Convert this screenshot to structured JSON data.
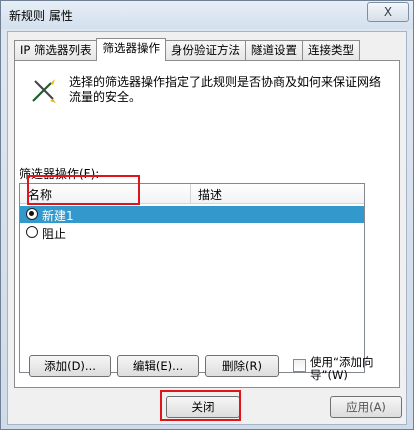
{
  "window": {
    "title": "新规则 属性",
    "close_glyph": "X"
  },
  "tabs": [
    {
      "label": "IP 筛选器列表",
      "active": false
    },
    {
      "label": "筛选器操作",
      "active": true
    },
    {
      "label": "身份验证方法",
      "active": false
    },
    {
      "label": "隧道设置",
      "active": false
    },
    {
      "label": "连接类型",
      "active": false
    }
  ],
  "panel": {
    "description": "选择的筛选器操作指定了此规则是否协商及如何来保证网络流量的安全。",
    "list_label": "筛选器操作(F):",
    "columns": [
      "名称",
      "描述"
    ],
    "rows": [
      {
        "name": "新建1",
        "description": "",
        "checked": true,
        "selected": true
      },
      {
        "name": "阻止",
        "description": "",
        "checked": false,
        "selected": false
      }
    ],
    "buttons": {
      "add": "添加(D)...",
      "edit": "编辑(E)...",
      "delete": "删除(R)"
    },
    "wizard_checkbox": {
      "label": "使用“添加向导”(W)",
      "checked": false
    }
  },
  "footer": {
    "close": "关闭",
    "apply_partial": "应用(A)"
  },
  "colors": {
    "selection": "#3399cc",
    "highlight_box": "#e0141b"
  }
}
